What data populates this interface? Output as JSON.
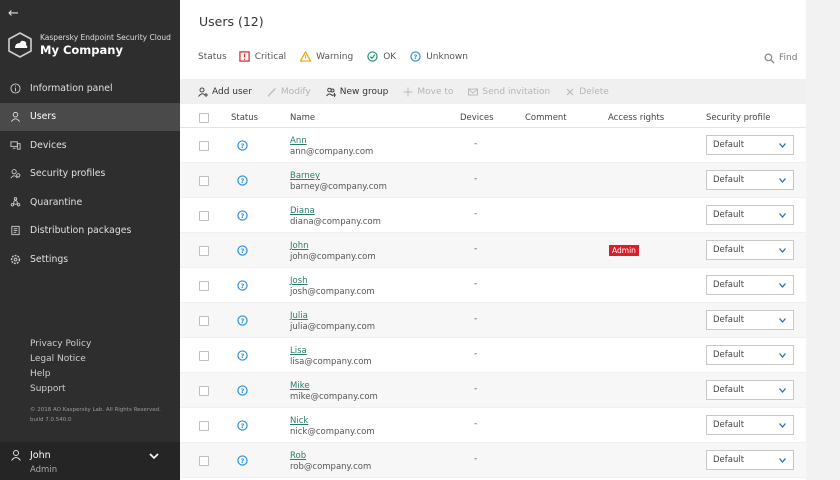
{
  "sidebar": {
    "back_glyph": "←",
    "product_name": "Kaspersky Endpoint Security Cloud",
    "company_name": "My Company",
    "nav": [
      {
        "label": "Information panel",
        "icon": "info-icon",
        "active": false
      },
      {
        "label": "Users",
        "icon": "user-icon",
        "active": true
      },
      {
        "label": "Devices",
        "icon": "devices-icon",
        "active": false
      },
      {
        "label": "Security profiles",
        "icon": "security-profile-icon",
        "active": false
      },
      {
        "label": "Quarantine",
        "icon": "quarantine-icon",
        "active": false
      },
      {
        "label": "Distribution packages",
        "icon": "package-icon",
        "active": false
      },
      {
        "label": "Settings",
        "icon": "gear-icon",
        "active": false
      }
    ],
    "footer_links": [
      "Privacy Policy",
      "Legal Notice",
      "Help",
      "Support"
    ],
    "copyright": "© 2018 AO Kaspersky Lab. All Rights Reserved.",
    "build": "build 7.0.540.0",
    "user": {
      "name": "John",
      "role": "Admin"
    }
  },
  "main": {
    "title": "Users (12)",
    "status_label": "Status",
    "status_filters": [
      {
        "label": "Critical",
        "icon": "critical-icon",
        "color": "#d6202b"
      },
      {
        "label": "Warning",
        "icon": "warning-icon",
        "color": "#f0a400"
      },
      {
        "label": "OK",
        "icon": "ok-icon",
        "color": "#2a8c6a"
      },
      {
        "label": "Unknown",
        "icon": "unknown-icon",
        "color": "#2b8fd4"
      }
    ],
    "find_label": "Find",
    "toolbar": {
      "add_user": "Add user",
      "modify": "Modify",
      "new_group": "New group",
      "move_to": "Move to",
      "send_invitation": "Send invitation",
      "delete": "Delete"
    },
    "columns": {
      "status": "Status",
      "name": "Name",
      "devices": "Devices",
      "comment": "Comment",
      "access_rights": "Access rights",
      "security_profile": "Security profile"
    },
    "rows": [
      {
        "name": "Ann",
        "email": "ann@company.com",
        "devices": "-",
        "access": "",
        "profile": "Default"
      },
      {
        "name": "Barney",
        "email": "barney@company.com",
        "devices": "-",
        "access": "",
        "profile": "Default"
      },
      {
        "name": "Diana",
        "email": "diana@company.com",
        "devices": "-",
        "access": "",
        "profile": "Default"
      },
      {
        "name": "John",
        "email": "john@company.com",
        "devices": "-",
        "access": "Admin",
        "profile": "Default"
      },
      {
        "name": "Josh",
        "email": "josh@company.com",
        "devices": "-",
        "access": "",
        "profile": "Default"
      },
      {
        "name": "Julia",
        "email": "julia@company.com",
        "devices": "-",
        "access": "",
        "profile": "Default"
      },
      {
        "name": "Lisa",
        "email": "lisa@company.com",
        "devices": "-",
        "access": "",
        "profile": "Default"
      },
      {
        "name": "Mike",
        "email": "mike@company.com",
        "devices": "-",
        "access": "",
        "profile": "Default"
      },
      {
        "name": "Nick",
        "email": "nick@company.com",
        "devices": "-",
        "access": "",
        "profile": "Default"
      },
      {
        "name": "Rob",
        "email": "rob@company.com",
        "devices": "-",
        "access": "",
        "profile": "Default"
      }
    ]
  },
  "colors": {
    "sidebar_bg": "#2e2e2e",
    "link": "#2a7c6a",
    "admin_badge": "#d6202b"
  }
}
